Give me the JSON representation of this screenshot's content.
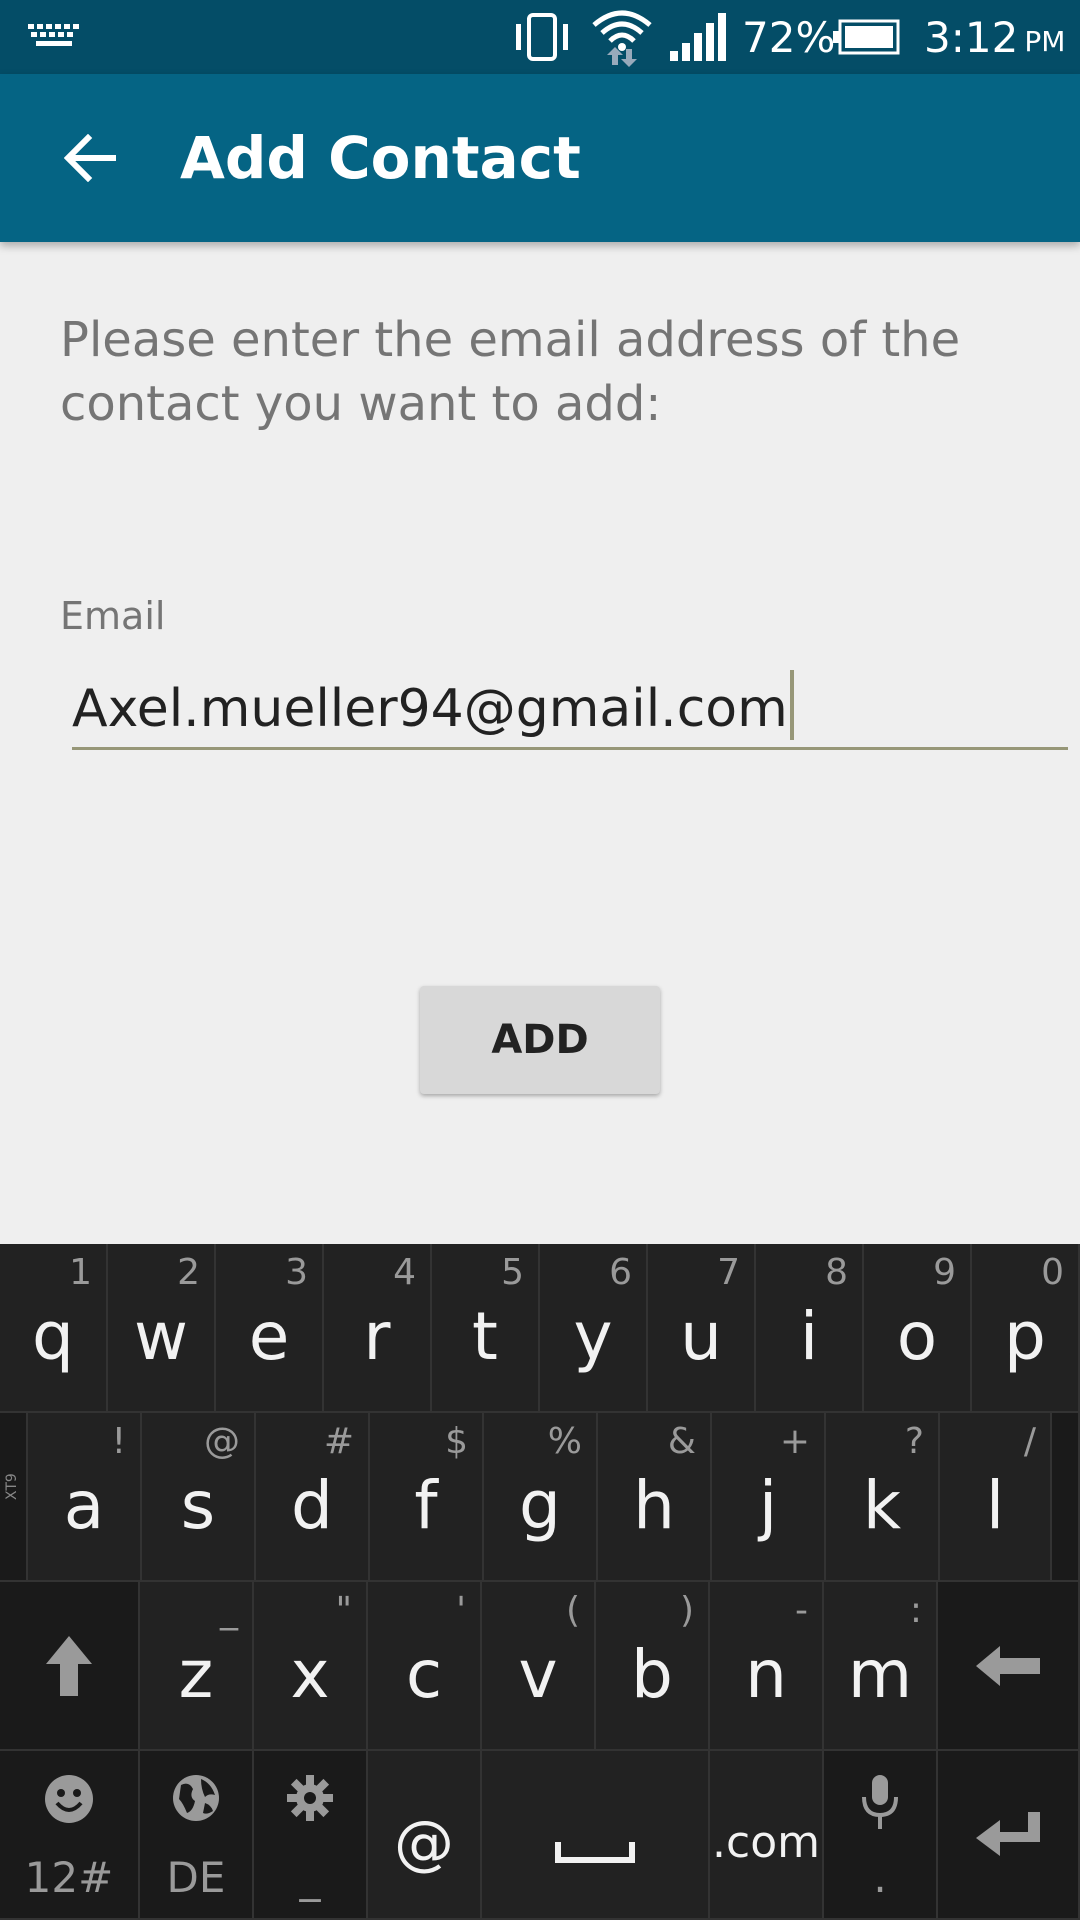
{
  "status_bar": {
    "battery_percent": "72%",
    "time": "3:12",
    "ampm": "PM"
  },
  "app_bar": {
    "title": "Add Contact"
  },
  "content": {
    "instructions": "Please enter the email address of the contact you want to add:",
    "email_label": "Email",
    "email_value": "Axel.mueller94@gmail.com",
    "add_button": "ADD"
  },
  "keyboard": {
    "row1": [
      {
        "key": "q",
        "hint": "1"
      },
      {
        "key": "w",
        "hint": "2"
      },
      {
        "key": "e",
        "hint": "3"
      },
      {
        "key": "r",
        "hint": "4"
      },
      {
        "key": "t",
        "hint": "5"
      },
      {
        "key": "y",
        "hint": "6"
      },
      {
        "key": "u",
        "hint": "7"
      },
      {
        "key": "i",
        "hint": "8"
      },
      {
        "key": "o",
        "hint": "9"
      },
      {
        "key": "p",
        "hint": "0"
      }
    ],
    "row2": [
      {
        "key": "a",
        "hint": "!"
      },
      {
        "key": "s",
        "hint": "@"
      },
      {
        "key": "d",
        "hint": "#"
      },
      {
        "key": "f",
        "hint": "$"
      },
      {
        "key": "g",
        "hint": "%"
      },
      {
        "key": "h",
        "hint": "&"
      },
      {
        "key": "j",
        "hint": "+"
      },
      {
        "key": "k",
        "hint": "?"
      },
      {
        "key": "l",
        "hint": "/"
      }
    ],
    "row3": [
      {
        "key": "z",
        "hint": "_"
      },
      {
        "key": "x",
        "hint": "\""
      },
      {
        "key": "c",
        "hint": "'"
      },
      {
        "key": "v",
        "hint": "("
      },
      {
        "key": "b",
        "hint": ")"
      },
      {
        "key": "n",
        "hint": "-"
      },
      {
        "key": "m",
        "hint": ":"
      }
    ],
    "row4": {
      "symbols_label": "12#",
      "language_label": "DE",
      "settings_label": "_",
      "at_key": "@",
      "dotcom_key": ".com",
      "mic_label": "."
    },
    "side_label": "XT9"
  },
  "colors": {
    "status_bar": "#044d67",
    "app_bar": "#056484",
    "background": "#efefef",
    "keyboard": "#171717"
  }
}
